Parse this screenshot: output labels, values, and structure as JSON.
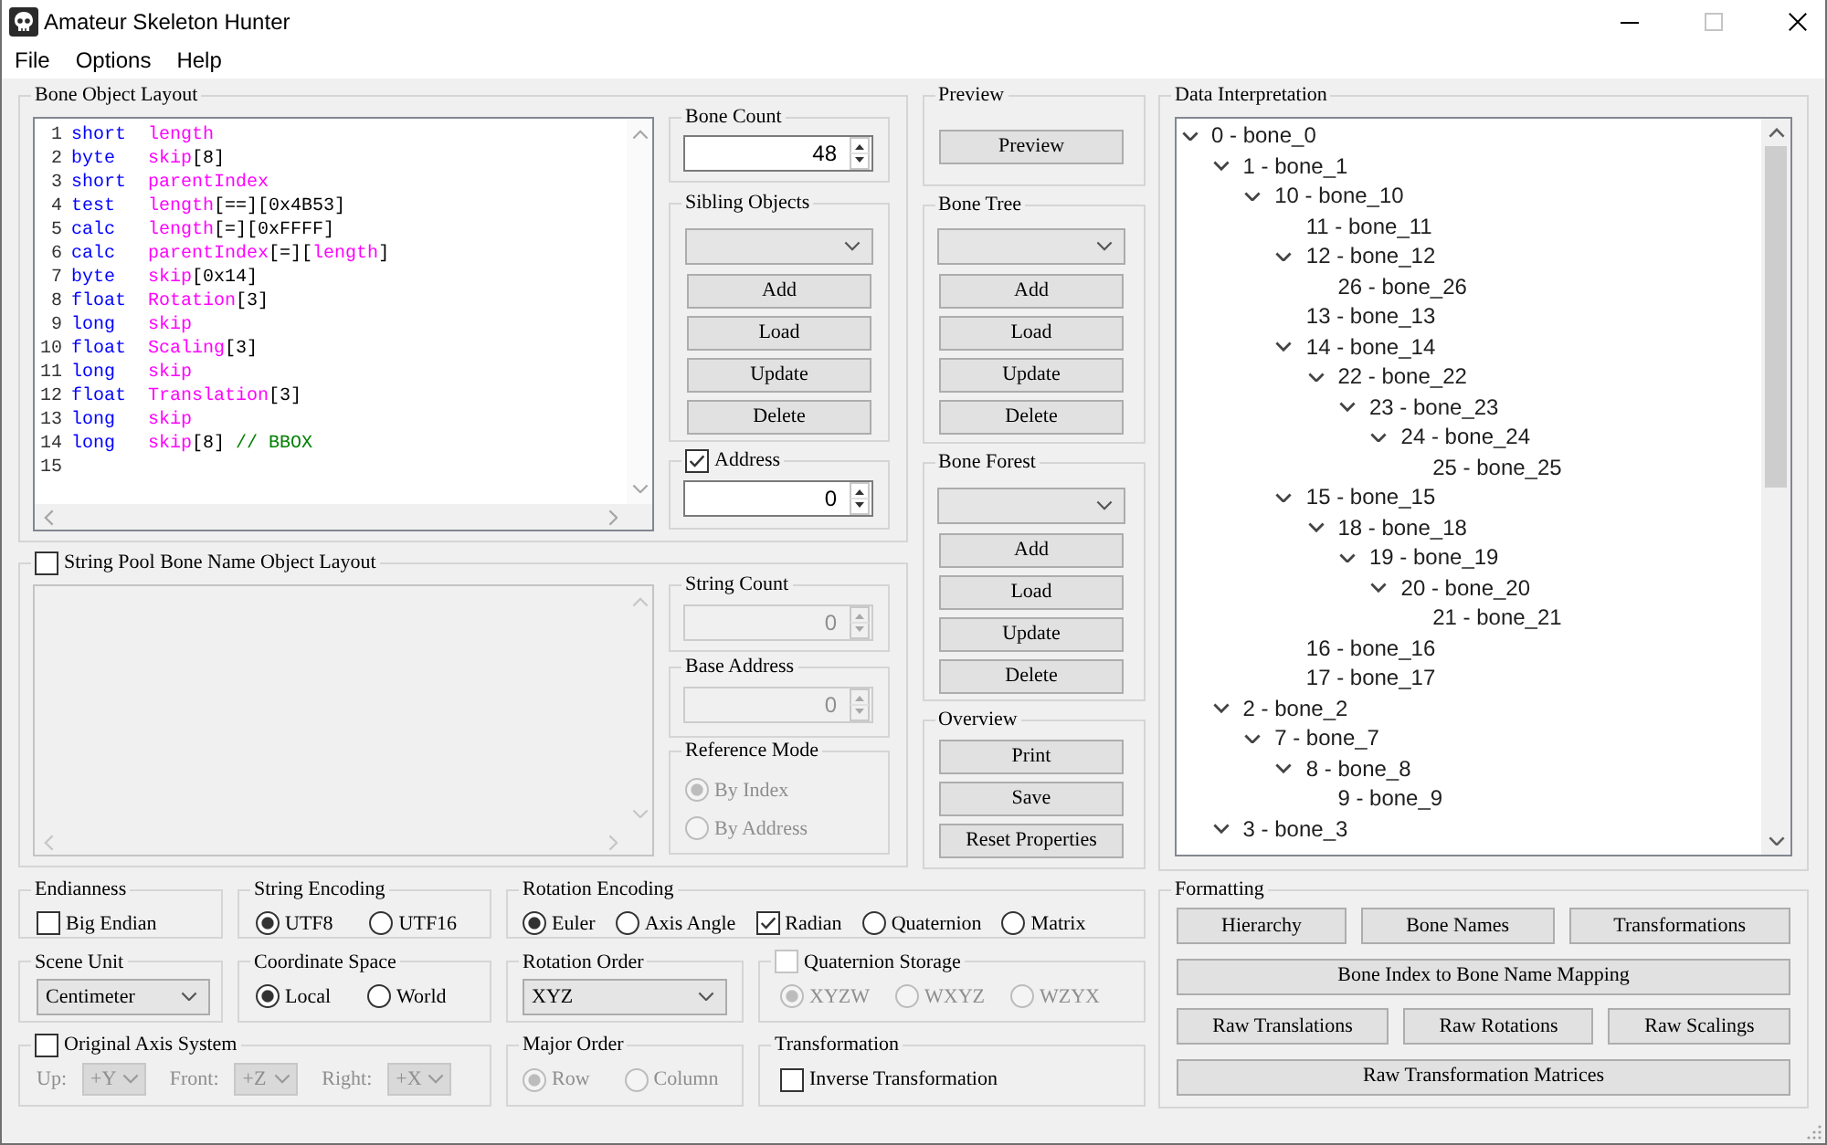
{
  "window": {
    "title": "Amateur Skeleton Hunter",
    "controls": [
      {
        "kind": "minimize",
        "disabled": false
      },
      {
        "kind": "maximize",
        "disabled": true
      },
      {
        "kind": "close",
        "disabled": false
      }
    ]
  },
  "menu": [
    "File",
    "Options",
    "Help"
  ],
  "bone_object_layout": {
    "title": "Bone Object Layout",
    "code_lines": [
      {
        "number": "1",
        "tokens": [
          {
            "kind": "type",
            "text": "short  "
          },
          {
            "kind": "name",
            "text": "length"
          }
        ]
      },
      {
        "number": "2",
        "tokens": [
          {
            "kind": "type",
            "text": "byte   "
          },
          {
            "kind": "name",
            "text": "skip"
          },
          {
            "kind": "punct",
            "text": "[8]"
          }
        ]
      },
      {
        "number": "3",
        "tokens": [
          {
            "kind": "type",
            "text": "short  "
          },
          {
            "kind": "name",
            "text": "parentIndex"
          }
        ]
      },
      {
        "number": "4",
        "tokens": [
          {
            "kind": "type",
            "text": "test   "
          },
          {
            "kind": "name",
            "text": "length"
          },
          {
            "kind": "punct",
            "text": "[==][0x4B53]"
          }
        ]
      },
      {
        "number": "5",
        "tokens": [
          {
            "kind": "type",
            "text": "calc   "
          },
          {
            "kind": "name",
            "text": "length"
          },
          {
            "kind": "punct",
            "text": "[=][0xFFFF]"
          }
        ]
      },
      {
        "number": "6",
        "tokens": [
          {
            "kind": "type",
            "text": "calc   "
          },
          {
            "kind": "name",
            "text": "parentIndex"
          },
          {
            "kind": "punct",
            "text": "[=]["
          },
          {
            "kind": "name",
            "text": "length"
          },
          {
            "kind": "punct",
            "text": "]"
          }
        ]
      },
      {
        "number": "7",
        "tokens": [
          {
            "kind": "type",
            "text": "byte   "
          },
          {
            "kind": "name",
            "text": "skip"
          },
          {
            "kind": "punct",
            "text": "[0x14]"
          }
        ]
      },
      {
        "number": "8",
        "tokens": [
          {
            "kind": "type",
            "text": "float  "
          },
          {
            "kind": "name",
            "text": "Rotation"
          },
          {
            "kind": "punct",
            "text": "[3]"
          }
        ]
      },
      {
        "number": "9",
        "tokens": [
          {
            "kind": "type",
            "text": "long   "
          },
          {
            "kind": "name",
            "text": "skip"
          }
        ]
      },
      {
        "number": "10",
        "tokens": [
          {
            "kind": "type",
            "text": "float  "
          },
          {
            "kind": "name",
            "text": "Scaling"
          },
          {
            "kind": "punct",
            "text": "[3]"
          }
        ]
      },
      {
        "number": "11",
        "tokens": [
          {
            "kind": "type",
            "text": "long   "
          },
          {
            "kind": "name",
            "text": "skip"
          }
        ]
      },
      {
        "number": "12",
        "tokens": [
          {
            "kind": "type",
            "text": "float  "
          },
          {
            "kind": "name",
            "text": "Translation"
          },
          {
            "kind": "punct",
            "text": "[3]"
          }
        ]
      },
      {
        "number": "13",
        "tokens": [
          {
            "kind": "type",
            "text": "long   "
          },
          {
            "kind": "name",
            "text": "skip"
          }
        ]
      },
      {
        "number": "14",
        "tokens": [
          {
            "kind": "type",
            "text": "long   "
          },
          {
            "kind": "name",
            "text": "skip"
          },
          {
            "kind": "punct",
            "text": "[8] "
          },
          {
            "kind": "comment",
            "text": "// BBOX"
          }
        ]
      },
      {
        "number": "15"
      }
    ],
    "bone_count": {
      "title": "Bone Count",
      "spinbox": "48"
    },
    "sibling_objects": {
      "title": "Sibling Objects",
      "buttons": [
        "Add",
        "Load",
        "Update",
        "Delete"
      ]
    },
    "address": {
      "title": "Address",
      "checked": true,
      "spinbox": "0"
    }
  },
  "string_pool": {
    "title": "String Pool Bone Name Object Layout",
    "checked": false,
    "string_count": {
      "title": "String Count",
      "spinbox": "0"
    },
    "base_address": {
      "title": "Base Address",
      "spinbox": "0"
    },
    "reference_mode": {
      "title": "Reference Mode",
      "options": [
        {
          "kind": "radio",
          "label": "By Index",
          "selected": true
        },
        {
          "kind": "radio",
          "label": "By Address",
          "selected": false
        }
      ]
    }
  },
  "preview": {
    "title": "Preview",
    "buttons": [
      "Preview"
    ]
  },
  "bone_tree": {
    "title": "Bone Tree",
    "buttons": [
      "Add",
      "Load",
      "Update",
      "Delete"
    ]
  },
  "bone_forest": {
    "title": "Bone Forest",
    "buttons": [
      "Add",
      "Load",
      "Update",
      "Delete"
    ]
  },
  "overview": {
    "title": "Overview",
    "buttons": [
      "Print",
      "Save",
      "Reset Properties"
    ]
  },
  "data_interpretation": {
    "title": "Data Interpretation",
    "tree": [
      {
        "label": "0 - bone_0",
        "expanded": true,
        "children": [
          {
            "label": "1 - bone_1",
            "expanded": true,
            "children": [
              {
                "label": "10 - bone_10",
                "expanded": true,
                "children": [
                  {
                    "label": "11 - bone_11"
                  },
                  {
                    "label": "12 - bone_12",
                    "expanded": true,
                    "children": [
                      {
                        "label": "26 - bone_26"
                      }
                    ]
                  },
                  {
                    "label": "13 - bone_13"
                  },
                  {
                    "label": "14 - bone_14",
                    "expanded": true,
                    "children": [
                      {
                        "label": "22 - bone_22",
                        "expanded": true,
                        "children": [
                          {
                            "label": "23 - bone_23",
                            "expanded": true,
                            "children": [
                              {
                                "label": "24 - bone_24",
                                "expanded": true,
                                "children": [
                                  {
                                    "label": "25 - bone_25"
                                  }
                                ]
                              }
                            ]
                          }
                        ]
                      }
                    ]
                  },
                  {
                    "label": "15 - bone_15",
                    "expanded": true,
                    "children": [
                      {
                        "label": "18 - bone_18",
                        "expanded": true,
                        "children": [
                          {
                            "label": "19 - bone_19",
                            "expanded": true,
                            "children": [
                              {
                                "label": "20 - bone_20",
                                "expanded": true,
                                "children": [
                                  {
                                    "label": "21 - bone_21"
                                  }
                                ]
                              }
                            ]
                          }
                        ]
                      }
                    ]
                  },
                  {
                    "label": "16 - bone_16"
                  },
                  {
                    "label": "17 - bone_17"
                  }
                ]
              }
            ]
          },
          {
            "label": "2 - bone_2",
            "expanded": true,
            "children": [
              {
                "label": "7 - bone_7",
                "expanded": true,
                "children": [
                  {
                    "label": "8 - bone_8",
                    "expanded": true,
                    "children": [
                      {
                        "label": "9 - bone_9"
                      }
                    ]
                  }
                ]
              }
            ]
          },
          {
            "label": "3 - bone_3",
            "expanded": true
          }
        ]
      }
    ]
  },
  "endianness": {
    "title": "Endianness",
    "options": [
      {
        "kind": "checkbox",
        "label": "Big Endian",
        "checked": false
      }
    ]
  },
  "string_encoding": {
    "title": "String Encoding",
    "options": [
      {
        "kind": "radio",
        "label": "UTF8",
        "selected": true
      },
      {
        "kind": "radio",
        "label": "UTF16",
        "selected": false
      }
    ]
  },
  "rotation_encoding": {
    "title": "Rotation Encoding",
    "options": [
      {
        "kind": "radio",
        "label": "Euler",
        "selected": true
      },
      {
        "kind": "radio",
        "label": "Axis Angle",
        "selected": false
      },
      {
        "kind": "checkbox",
        "label": "Radian",
        "checked": true
      },
      {
        "kind": "radio",
        "label": "Quaternion",
        "selected": false
      },
      {
        "kind": "radio",
        "label": "Matrix",
        "selected": false
      }
    ]
  },
  "scene_unit": {
    "title": "Scene Unit",
    "dropdown": "Centimeter"
  },
  "coordinate_space": {
    "title": "Coordinate Space",
    "options": [
      {
        "kind": "radio",
        "label": "Local",
        "selected": true
      },
      {
        "kind": "radio",
        "label": "World",
        "selected": false
      }
    ]
  },
  "rotation_order": {
    "title": "Rotation Order",
    "dropdown": "XYZ"
  },
  "quaternion_storage": {
    "title": "Quaternion Storage",
    "checked": false,
    "disabled": true,
    "options": [
      {
        "kind": "radio",
        "label": "XYZW",
        "selected": true
      },
      {
        "kind": "radio",
        "label": "WXYZ",
        "selected": false
      },
      {
        "kind": "radio",
        "label": "WZYX",
        "selected": false
      }
    ]
  },
  "original_axis_system": {
    "title": "Original Axis System",
    "checked": false,
    "axes": [
      {
        "label": "Up:",
        "value": "+Y"
      },
      {
        "label": "Front:",
        "value": "+Z"
      },
      {
        "label": "Right:",
        "value": "+X"
      }
    ]
  },
  "major_order": {
    "title": "Major Order",
    "disabled": true,
    "options": [
      {
        "kind": "radio",
        "label": "Row",
        "selected": true
      },
      {
        "kind": "radio",
        "label": "Column",
        "selected": false
      }
    ]
  },
  "transformation": {
    "title": "Transformation",
    "options": [
      {
        "kind": "checkbox",
        "label": "Inverse Transformation",
        "checked": false
      }
    ]
  },
  "formatting": {
    "title": "Formatting",
    "button_rows": [
      [
        "Hierarchy",
        "Bone Names",
        "Transformations"
      ],
      [
        "Bone Index to Bone Name Mapping"
      ],
      [
        "Raw Translations",
        "Raw Rotations",
        "Raw Scalings"
      ],
      [
        "Raw Transformation Matrices"
      ]
    ]
  }
}
